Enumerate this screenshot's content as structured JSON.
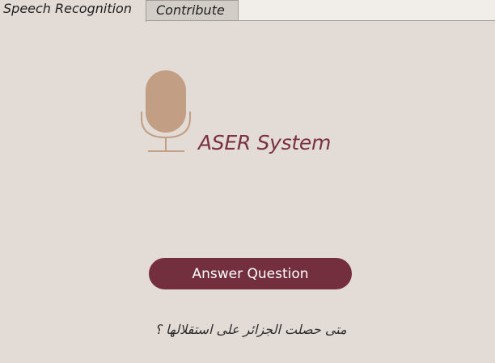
{
  "tabs": [
    {
      "label": "Speech Recognition",
      "active": true
    },
    {
      "label": "Contribute",
      "active": false
    }
  ],
  "app": {
    "title": "ASER System",
    "logo_icon": "microphone-icon"
  },
  "actions": {
    "answer_label": "Answer Question"
  },
  "question": {
    "text": "متى حصلت الجزائر على استقلالها ؟"
  },
  "colors": {
    "background": "#e3dbd6",
    "accent": "#742f3f",
    "mic": "#c29f84"
  }
}
